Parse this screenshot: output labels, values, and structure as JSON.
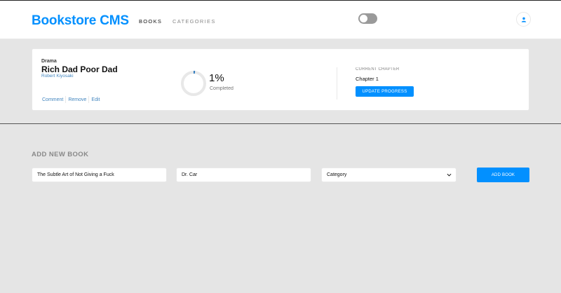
{
  "header": {
    "brand": "Bookstore CMS",
    "nav": [
      "BOOKS",
      "CATEGORIES"
    ],
    "user_icon": "user-icon"
  },
  "book": {
    "genre": "Drama",
    "title": "Rich Dad Poor Dad",
    "author": "Robert Kiyosaki",
    "actions": [
      "Comment",
      "Remove",
      "Edit"
    ],
    "progress_percent": 1,
    "progress_label": "1%",
    "completed_label": "Completed",
    "chapter_label": "CURRENT CHAPTER",
    "chapter_value": "Chapter 1",
    "update_button": "UPDATE PROGRESS"
  },
  "form": {
    "title": "ADD NEW BOOK",
    "title_value": "The Subtle Art of Not Giving a Fuck",
    "author_value": "Dr. Car",
    "category_value": "Category",
    "submit_label": "ADD BOOK"
  },
  "colors": {
    "primary": "#0290ff",
    "link": "#4386bf",
    "background": "#e5e5e5",
    "card": "#ffffff",
    "ring_track": "#e8e8e8"
  }
}
